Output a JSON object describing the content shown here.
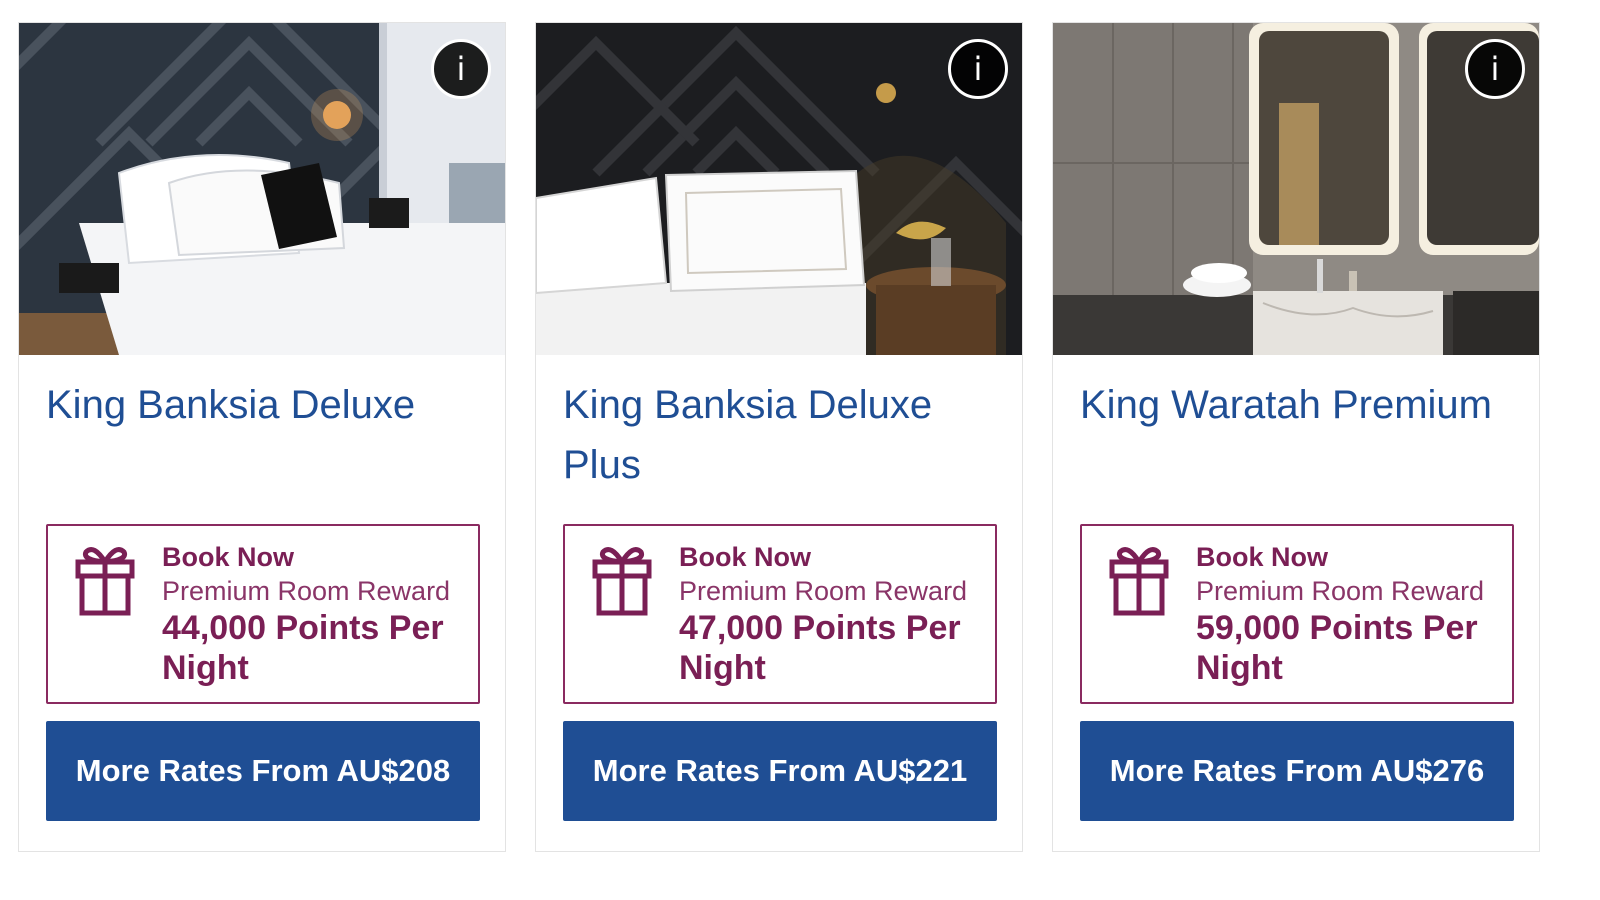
{
  "info_glyph": "i",
  "colors": {
    "accent_blue": "#1f4e94",
    "reward_plum": "#7a1f55"
  },
  "rooms": [
    {
      "name": "King Banksia Deluxe",
      "photo": "bedroom-photo",
      "reward": {
        "heading": "Book Now",
        "type": "Premium Room Reward",
        "points": "44,000 Points Per Night",
        "icon": "gift-icon"
      },
      "rates_label": "More Rates From AU$208"
    },
    {
      "name": "King Banksia Deluxe Plus",
      "photo": "bedroom-photo",
      "reward": {
        "heading": "Book Now",
        "type": "Premium Room Reward",
        "points": "47,000 Points Per Night",
        "icon": "gift-icon"
      },
      "rates_label": "More Rates From AU$221"
    },
    {
      "name": "King Waratah Premium",
      "photo": "bathroom-photo",
      "reward": {
        "heading": "Book Now",
        "type": "Premium Room Reward",
        "points": "59,000 Points Per Night",
        "icon": "gift-icon"
      },
      "rates_label": "More Rates From AU$276"
    }
  ]
}
